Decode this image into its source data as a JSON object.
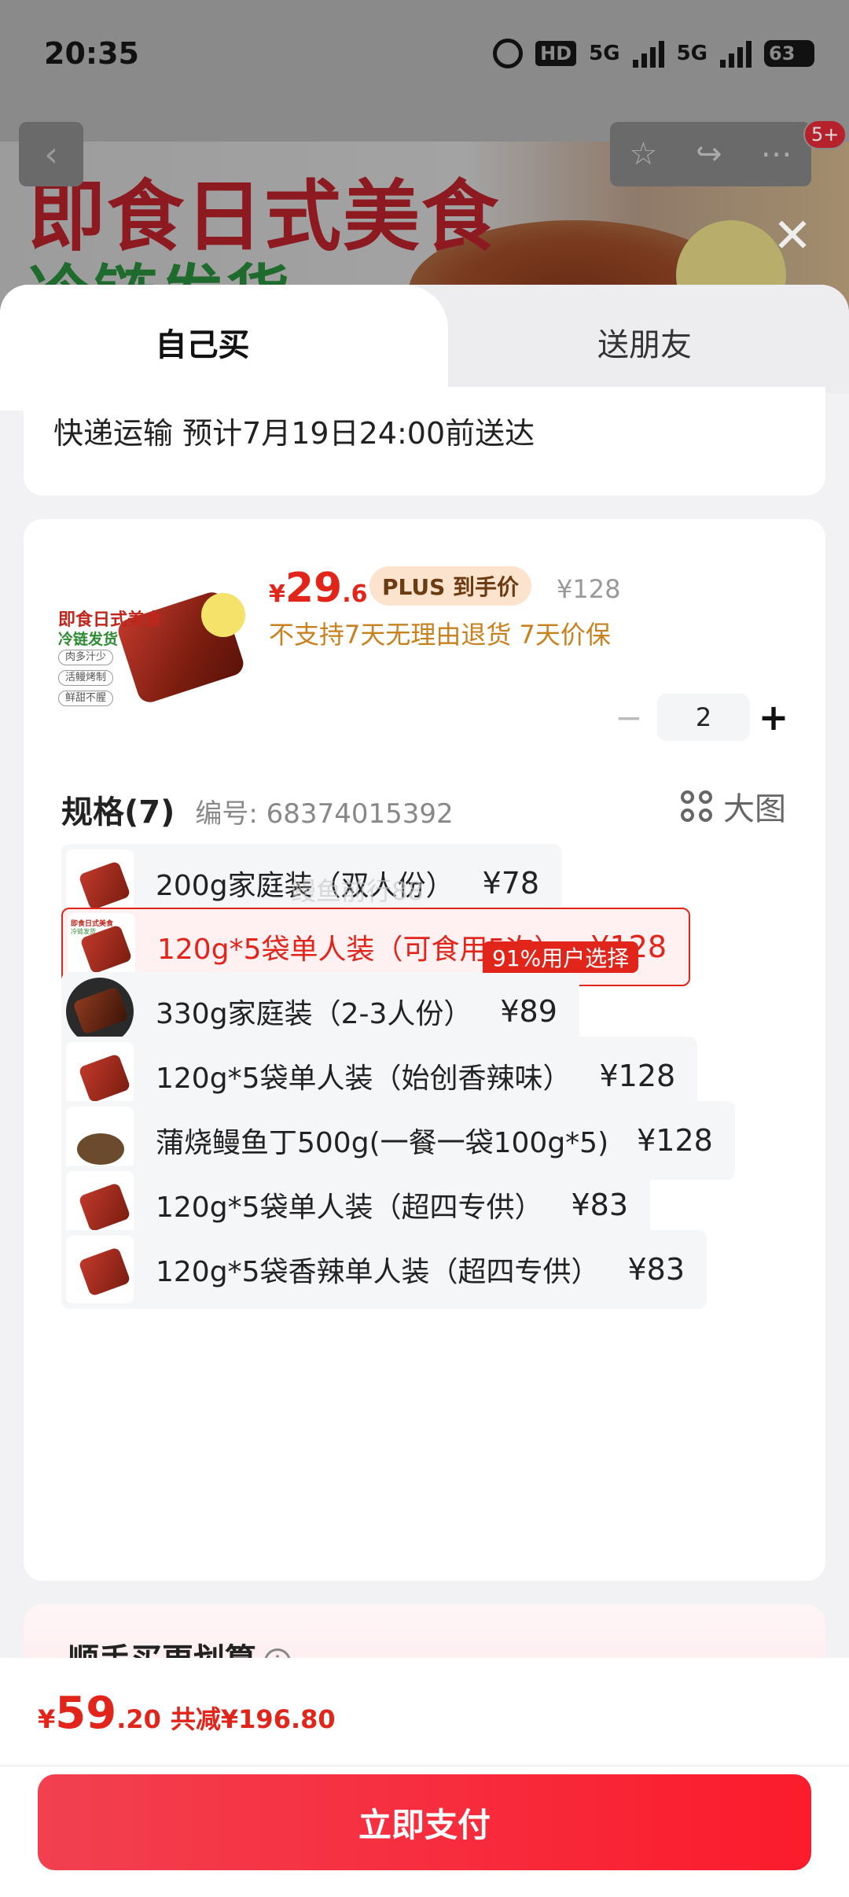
{
  "status_bar": {
    "time": "20:35",
    "hd_label": "HD",
    "network_1": "5G",
    "network_2": "5G",
    "battery": "63"
  },
  "background": {
    "banner_title": "即食日式美食",
    "banner_subtitle": "冷链发货",
    "badge": "5+"
  },
  "tabs": {
    "self": "自己买",
    "gift": "送朋友"
  },
  "delivery": {
    "text": "快递运输 预计7月19日24:00前送达"
  },
  "product": {
    "thumb": {
      "title": "即食日式美食",
      "subtitle": "冷链发货",
      "tags": [
        "肉多汁少",
        "活鳗烤制",
        "鲜甜不腥"
      ]
    },
    "price_symbol": "¥",
    "price_int": "29",
    "price_dec": ".6",
    "plus_label": "PLUS 到手价",
    "original_price": "¥128",
    "policy": "不支持7天无理由退货  7天价保",
    "quantity": "2",
    "qty_minus": "−",
    "qty_plus": "+"
  },
  "spec": {
    "title": "规格(7)",
    "number": "编号: 68374015392",
    "big_view": "大图",
    "selected_badge": "91%用户选择",
    "watermark": "鳗鱼前行88",
    "options": [
      {
        "name": "200g家庭装（双人份）",
        "price": "¥78"
      },
      {
        "name": "120g*5袋单人装（可食用5次）",
        "price": "¥128"
      },
      {
        "name": "330g家庭装（2-3人份）",
        "price": "¥89"
      },
      {
        "name": "120g*5袋单人装（始创香辣味）",
        "price": "¥128"
      },
      {
        "name": "蒲烧鳗鱼丁500g(一餐一袋100g*5)",
        "price": "¥128"
      },
      {
        "name": "120g*5袋单人装（超四专供）",
        "price": "¥83"
      },
      {
        "name": "120g*5袋香辣单人装（超四专供）",
        "price": "¥83"
      }
    ],
    "selected_index": 1
  },
  "more": {
    "title": "顺手买更划算",
    "info": "i"
  },
  "footer": {
    "total_symbol": "¥",
    "total_int": "59",
    "total_dec": ".20",
    "savings": "共减¥196.80",
    "pay_label": "立即支付"
  },
  "colors": {
    "accent": "#e1251b",
    "pay_button": "#fb1b2c",
    "plus_badge_bg": "#fbe3cd",
    "policy": "#c8811f"
  },
  "icons": [
    "alarm-icon",
    "back-icon",
    "star-icon",
    "share-icon",
    "more-icon",
    "close-icon",
    "grid-icon",
    "info-icon",
    "minus-icon",
    "plus-icon"
  ]
}
